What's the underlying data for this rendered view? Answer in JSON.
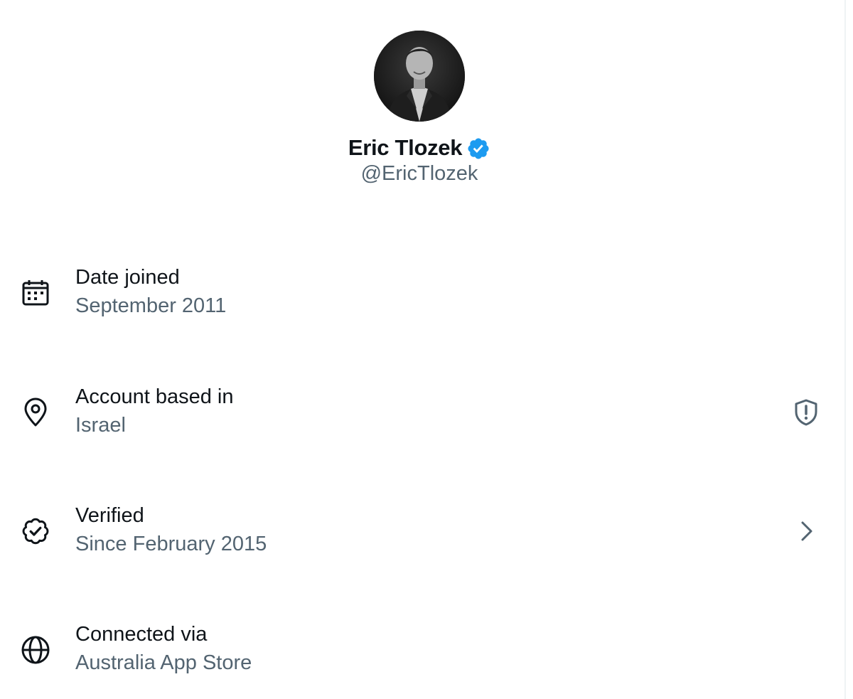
{
  "profile": {
    "display_name": "Eric Tlozek",
    "handle": "@EricTlozek",
    "verified": true
  },
  "about": {
    "items": [
      {
        "icon": "calendar-icon",
        "title": "Date joined",
        "value": "September 2011"
      },
      {
        "icon": "location-pin-icon",
        "title": "Account based in",
        "value": "Israel",
        "trailing_icon": "shield-alert-icon"
      },
      {
        "icon": "verified-badge-icon",
        "title": "Verified",
        "value": "Since February 2015",
        "trailing_icon": "chevron-right-icon"
      },
      {
        "icon": "globe-icon",
        "title": "Connected via",
        "value": "Australia App Store"
      }
    ]
  },
  "colors": {
    "primary_text": "#0f1419",
    "secondary_text": "#536471",
    "verified_blue": "#1d9bf0"
  }
}
